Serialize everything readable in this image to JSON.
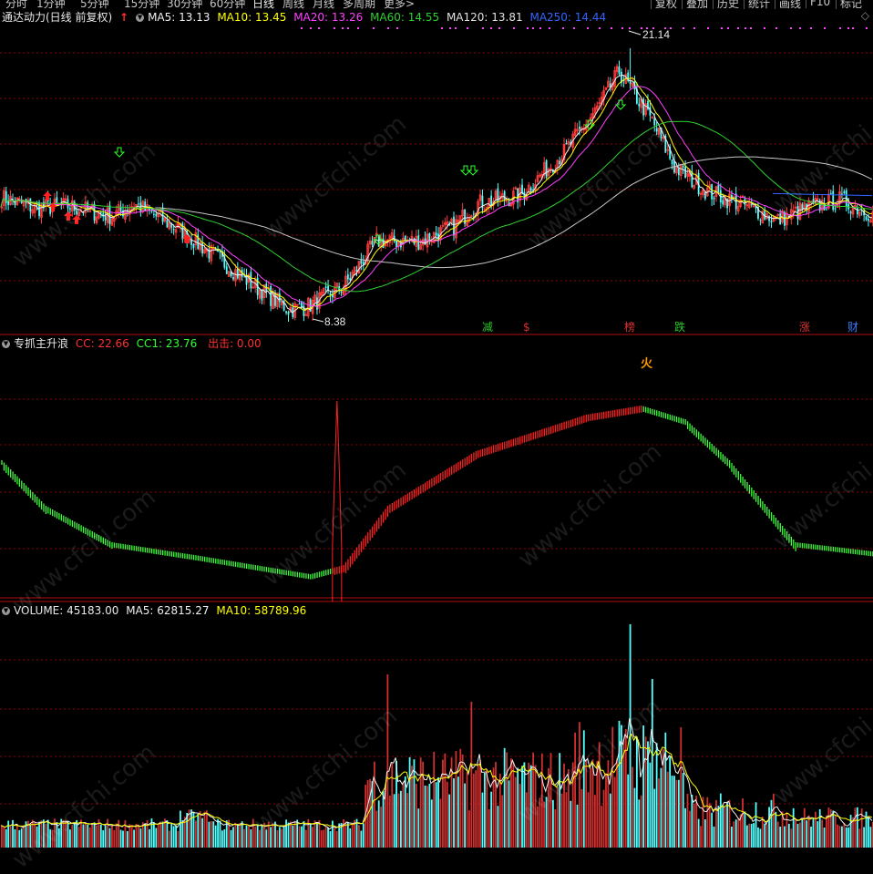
{
  "toolbar": {
    "periods": [
      "分时",
      "1分钟",
      "5分钟",
      "15分钟",
      "30分钟",
      "60分钟",
      "日线",
      "周线",
      "月线",
      "多周期",
      "更多>"
    ],
    "active_period": "日线",
    "right_buttons": [
      "复权",
      "叠加",
      "历史",
      "统计",
      "画线",
      "F10",
      "标记"
    ]
  },
  "main_legend": {
    "title": "通达动力(日线 前复权)",
    "ma5": "MA5: 13.13",
    "ma10": "MA10: 13.45",
    "ma20": "MA20: 13.26",
    "ma60": "MA60: 14.55",
    "ma120": "MA120: 13.81",
    "ma250": "MA250: 14.44"
  },
  "indicator_legend": {
    "title": "专抓主升浪",
    "cc": "CC: 22.66",
    "cc1": "CC1: 23.76",
    "out": "出击: 0.00"
  },
  "volume_legend": {
    "title": "VOLUME: 45183.00",
    "ma5": "MA5: 62815.27",
    "ma10": "MA10: 58789.96"
  },
  "annotations": {
    "high": "21.14",
    "low": "8.38"
  },
  "event_tags": [
    {
      "text": "减",
      "color": "#28c828"
    },
    {
      "text": "$",
      "color": "#e03030"
    },
    {
      "text": "榜",
      "color": "#e03030"
    },
    {
      "text": "跌",
      "color": "#28c828"
    },
    {
      "text": "涨",
      "color": "#e03030"
    },
    {
      "text": "财",
      "color": "#3a7cff"
    }
  ],
  "fire_icon": "火",
  "watermark": "www.cfchi.com",
  "colors": {
    "up": "#ff3c3c",
    "down": "#54ffff",
    "ma5": "#f0f0f0",
    "ma10": "#ffff00",
    "ma20": "#ff40ff",
    "ma60": "#30d030",
    "ma120": "#c8c8c8",
    "ma250": "#3366ff",
    "grid": "#8b0000",
    "ind_up": "#ff2020",
    "ind_down": "#3dff3d"
  },
  "chart_data": [
    {
      "type": "candlestick",
      "title": "通达动力(日线 前复权)",
      "ylim": [
        7.5,
        22.5
      ],
      "note_values": "approximate key closing prices over the visible period",
      "close_keypoints": [
        [
          0,
          13.9
        ],
        [
          15,
          13.4
        ],
        [
          30,
          13.5
        ],
        [
          50,
          13.0
        ],
        [
          60,
          13.6
        ],
        [
          80,
          12.4
        ],
        [
          100,
          10.8
        ],
        [
          115,
          9.6
        ],
        [
          130,
          8.5
        ],
        [
          138,
          8.6
        ],
        [
          155,
          9.6
        ],
        [
          170,
          11.8
        ],
        [
          190,
          11.8
        ],
        [
          205,
          12.5
        ],
        [
          215,
          13.6
        ],
        [
          235,
          14.0
        ],
        [
          255,
          16.1
        ],
        [
          270,
          18.2
        ],
        [
          280,
          20.0
        ],
        [
          295,
          17.6
        ],
        [
          305,
          15.4
        ],
        [
          320,
          14.2
        ],
        [
          340,
          13.4
        ],
        [
          352,
          12.8
        ],
        [
          365,
          13.4
        ],
        [
          380,
          13.8
        ],
        [
          395,
          13.1
        ]
      ],
      "high": 21.14,
      "low": 8.38,
      "series": [
        {
          "name": "MA5",
          "last": 13.13
        },
        {
          "name": "MA10",
          "last": 13.45
        },
        {
          "name": "MA20",
          "last": 13.26
        },
        {
          "name": "MA60",
          "last": 14.55
        },
        {
          "name": "MA120",
          "last": 13.81
        },
        {
          "name": "MA250",
          "last": 14.44
        }
      ]
    },
    {
      "type": "bar",
      "title": "专抓主升浪",
      "series": [
        {
          "name": "CC",
          "last": 22.66
        },
        {
          "name": "CC1",
          "last": 23.76
        },
        {
          "name": "出击",
          "last": 0.0
        }
      ],
      "ylim": [
        0,
        45
      ],
      "keypoints": [
        [
          0,
          30
        ],
        [
          20,
          20
        ],
        [
          50,
          12
        ],
        [
          90,
          9
        ],
        [
          140,
          5
        ],
        [
          155,
          7
        ],
        [
          175,
          20
        ],
        [
          215,
          32
        ],
        [
          265,
          40
        ],
        [
          290,
          42
        ],
        [
          310,
          39
        ],
        [
          330,
          30
        ],
        [
          360,
          12
        ],
        [
          395,
          10
        ]
      ],
      "spike_index": 152
    },
    {
      "type": "bar",
      "title": "VOLUME",
      "series": [
        {
          "name": "VOLUME",
          "last": 45183.0
        },
        {
          "name": "MA5",
          "last": 62815.27
        },
        {
          "name": "MA10",
          "last": 58789.96
        }
      ]
    }
  ]
}
